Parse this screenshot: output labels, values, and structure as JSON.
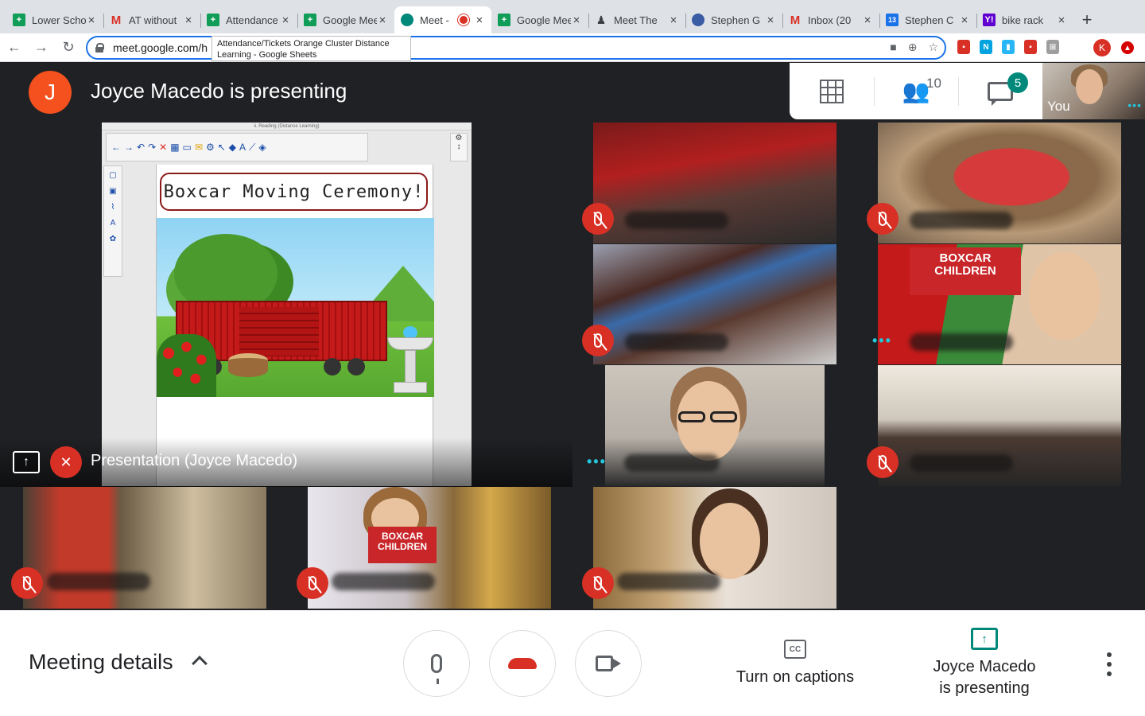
{
  "browser": {
    "tabs": [
      {
        "title": "Lower School",
        "favicon": "sheets-icon",
        "fav_text": "+"
      },
      {
        "title": "AT without",
        "favicon": "gmail-icon",
        "fav_text": "M"
      },
      {
        "title": "Attendance",
        "favicon": "sheets-icon",
        "fav_text": "+"
      },
      {
        "title": "Google Meet",
        "favicon": "sheets-icon",
        "fav_text": "+"
      },
      {
        "title": "Meet -",
        "favicon": "meet-icon",
        "fav_text": "",
        "active": true,
        "recording": true
      },
      {
        "title": "Google Meet",
        "favicon": "sheets-icon",
        "fav_text": "+"
      },
      {
        "title": "Meet The",
        "favicon": "person-icon",
        "fav_text": "♟"
      },
      {
        "title": "Stephen G",
        "favicon": "globe-icon",
        "fav_text": ""
      },
      {
        "title": "Inbox (20",
        "favicon": "gmail-icon",
        "fav_text": "M"
      },
      {
        "title": "Stephen C",
        "favicon": "calendar-icon",
        "fav_text": "13"
      },
      {
        "title": "bike rack",
        "favicon": "yahoo-icon",
        "fav_text": "Y!"
      }
    ],
    "new_tab_label": "+",
    "url": "meet.google.com/h",
    "tooltip": "Attendance/Tickets Orange Cluster Distance Learning - Google Sheets",
    "profile_initial": "K"
  },
  "meet": {
    "presenter_initial": "J",
    "presenter_banner": "Joyce Macedo is presenting",
    "participant_count": "10",
    "chat_badge": "5",
    "self_label": "You",
    "dots": "•••",
    "presentation": {
      "label": "Presentation (Joyce Macedo)",
      "window_title": "ii. Reading (Distance Learning)",
      "slide_title": "Boxcar Moving Ceremony!",
      "book_text": "BOXCAR CHILDREN"
    }
  },
  "controls": {
    "meeting_details": "Meeting details",
    "captions": "Turn on captions",
    "cc_text": "CC",
    "presenting_line1": "Joyce Macedo",
    "presenting_line2": "is presenting"
  },
  "colors": {
    "mute_red": "#d93025",
    "teal": "#00897b",
    "avatar_orange": "#f4511e",
    "omnibox_blue": "#1a73e8"
  }
}
